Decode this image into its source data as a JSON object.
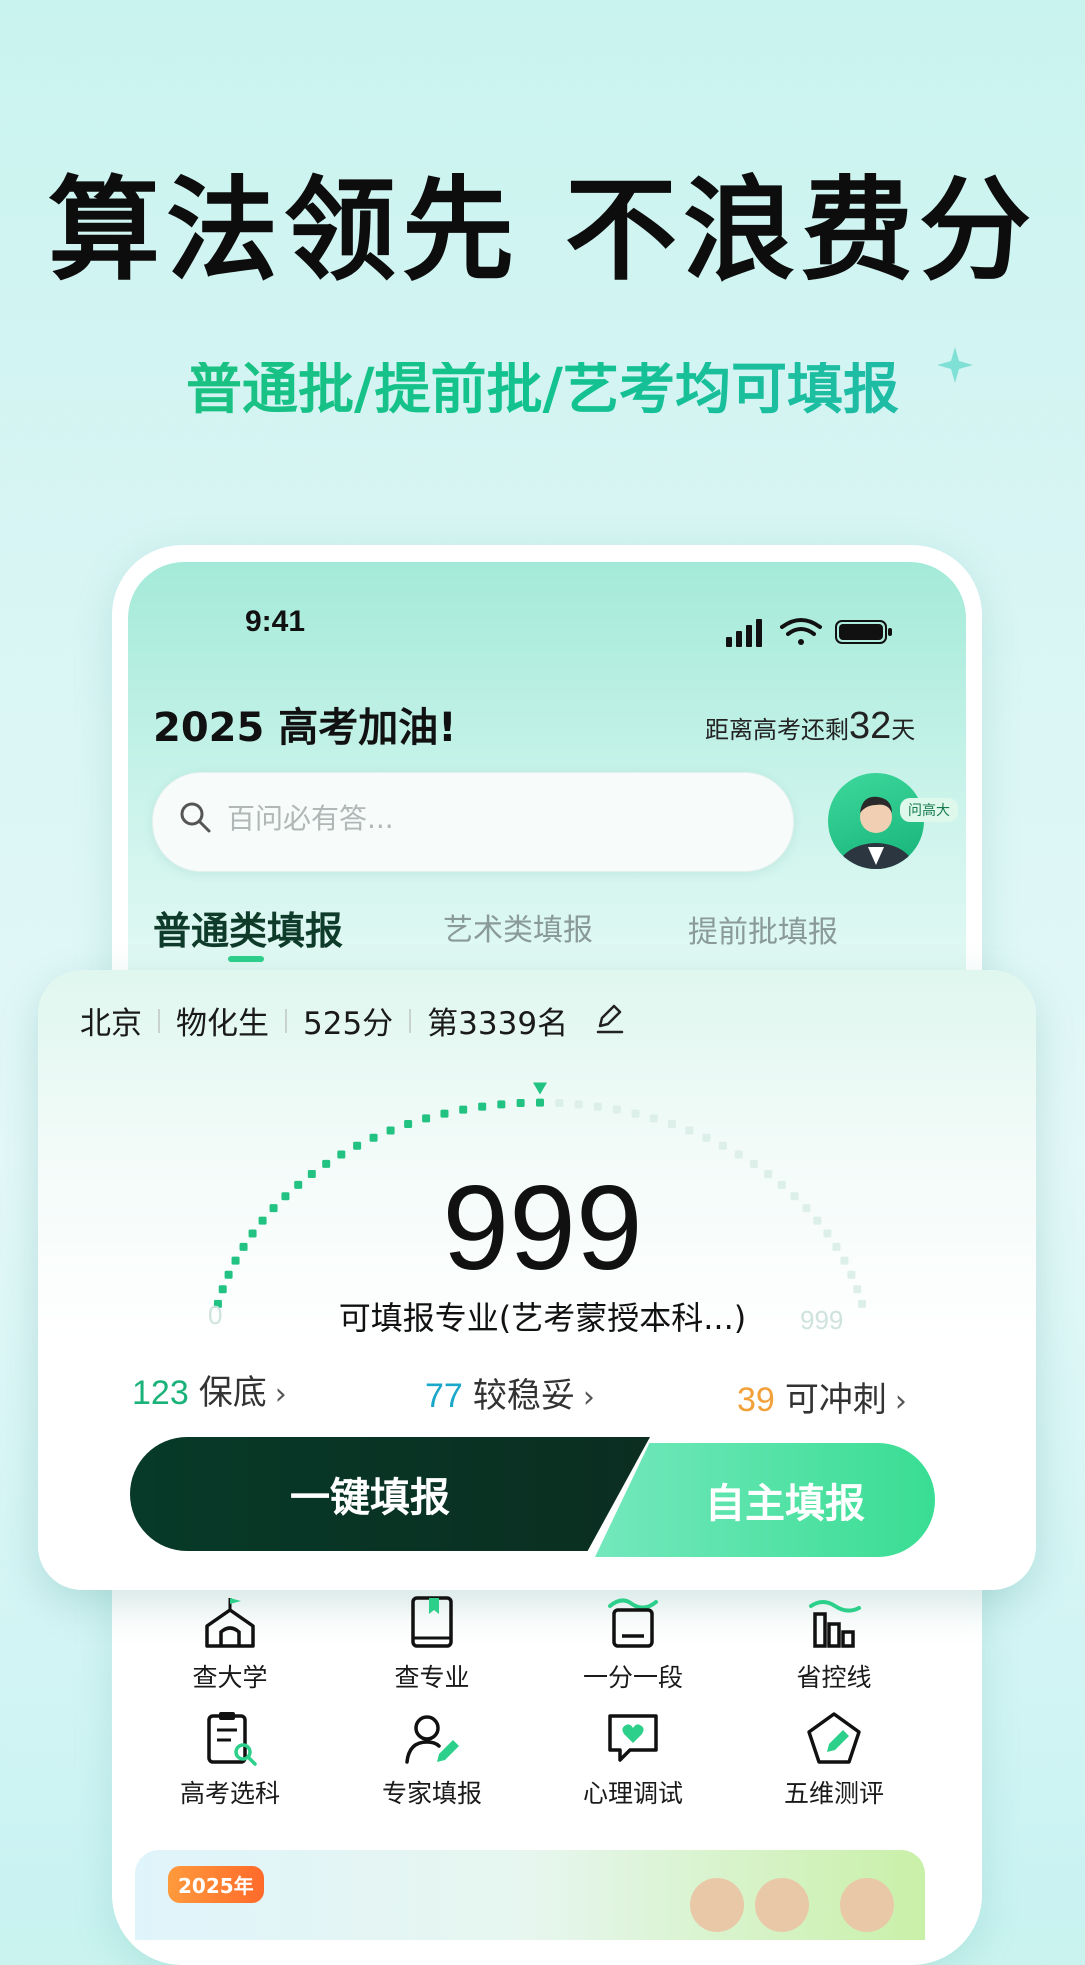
{
  "hero": {
    "title": "算法领先 不浪费分",
    "subtitle": "普通批/提前批/艺考均可填报"
  },
  "status_bar": {
    "time": "9:41"
  },
  "header": {
    "greeting": "2025 高考加油!",
    "countdown_prefix": "距离高考还剩",
    "countdown_days": "32",
    "countdown_unit": "天"
  },
  "search": {
    "placeholder": "百问必有答..."
  },
  "assistant": {
    "badge": "问高大"
  },
  "tabs": [
    {
      "label": "普通类填报",
      "active": true
    },
    {
      "label": "艺术类填报",
      "active": false
    },
    {
      "label": "提前批填报",
      "active": false
    }
  ],
  "profile": {
    "region": "北京",
    "subjects": "物化生",
    "score": "525分",
    "rank": "第3339名"
  },
  "gauge": {
    "value": "999",
    "caption": "可填报专业(艺考蒙授本科...)",
    "min": "0",
    "max": "999",
    "fill_fraction": 0.5
  },
  "stats": [
    {
      "count": "123",
      "label": "保底",
      "color": "#1bb27a"
    },
    {
      "count": "77",
      "label": "较稳妥",
      "color": "#1aa7c9"
    },
    {
      "count": "39",
      "label": "可冲刺",
      "color": "#f2a13a"
    }
  ],
  "actions": {
    "one_click": "一键填报",
    "manual": "自主填报"
  },
  "tools": [
    {
      "label": "查大学",
      "icon": "university-icon"
    },
    {
      "label": "查专业",
      "icon": "book-icon"
    },
    {
      "label": "一分一段",
      "icon": "score-segment-icon"
    },
    {
      "label": "省控线",
      "icon": "bar-chart-icon"
    },
    {
      "label": "高考选科",
      "icon": "clipboard-search-icon"
    },
    {
      "label": "专家填报",
      "icon": "expert-icon"
    },
    {
      "label": "心理调试",
      "icon": "heart-chat-icon"
    },
    {
      "label": "五维测评",
      "icon": "pentagon-icon"
    }
  ],
  "banner": {
    "badge": "2025年"
  },
  "colors": {
    "brand_green": "#2dd08a",
    "dark_green": "#073a28"
  }
}
